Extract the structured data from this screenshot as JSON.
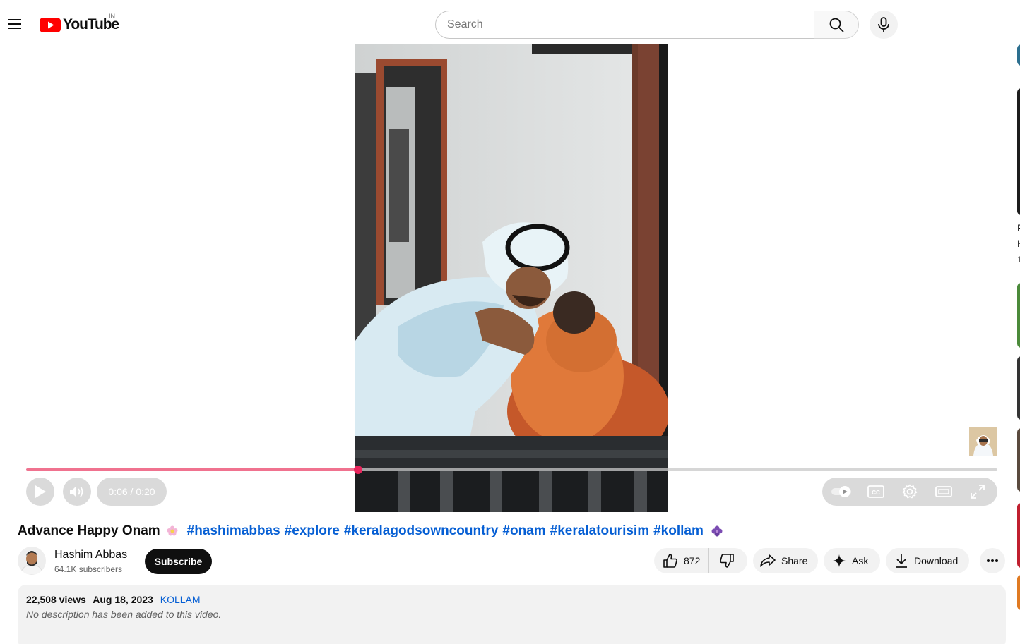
{
  "header": {
    "logo_text": "YouTube",
    "country_code": "IN",
    "search_placeholder": "Search"
  },
  "player": {
    "time_current": "0:06",
    "time_total": "0:20",
    "time_display": "0:06 / 0:20",
    "progress_fraction": 0.342
  },
  "video": {
    "title": "Advance Happy Onam",
    "hashtags": [
      "#hashimabbas",
      "#explore",
      "#keralagodsowncountry",
      "#onam",
      "#keralatourisim",
      "#kollam"
    ]
  },
  "channel": {
    "name": "Hashim Abbas",
    "subscribers": "64.1K subscribers",
    "subscribe_label": "Subscribe"
  },
  "actions": {
    "like_count": "872",
    "share_label": "Share",
    "ask_label": "Ask",
    "download_label": "Download"
  },
  "description": {
    "views": "22,508 views",
    "date": "Aug 18, 2023",
    "location": "KOLLAM",
    "text": "No description has been added to this video."
  },
  "sidebar_fragments": {
    "line1": "F",
    "line2": "H",
    "line3": "1"
  },
  "colors": {
    "brand_red": "#ff0000",
    "link_blue": "#065fd4",
    "progress_pink": "#f0728f",
    "scrubber": "#e8255c"
  }
}
